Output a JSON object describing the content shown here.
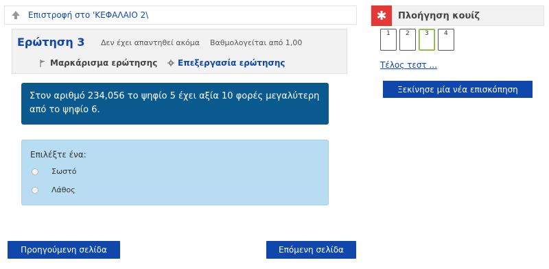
{
  "back": {
    "label": "Επιστροφή στο 'ΚΕΦΑΛΑΙΟ 2\\"
  },
  "question": {
    "number_prefix": "Ερώτηση",
    "number": "3",
    "state": "Δεν έχει απαντηθεί ακόμα",
    "grade": "Βαθμολογείται από 1,00",
    "flag_label": "Μαρκάρισμα ερώτησης",
    "edit_label": "Επεξεργασία ερώτησης",
    "text": "Στον αριθμό 234,056 το ψηφίο 5 έχει αξία 10 φορές μεγαλύτερη από το ψηφίο 6."
  },
  "answer": {
    "prompt": "Επιλέξτε ένα:",
    "options": [
      "Σωστό",
      "Λάθος"
    ]
  },
  "nav": {
    "prev_label": "Προηγούμενη σελίδα",
    "next_label": "Επόμενη σελίδα"
  },
  "quiz_nav": {
    "title": "Πλοήγηση κουίζ",
    "icon": "asterisk-icon",
    "buttons": [
      "1",
      "2",
      "3",
      "4"
    ],
    "current": "3",
    "finish_label": "Τέλος τεστ ...",
    "new_attempt_label": "Ξεκίνησε μία νέα επισκόπηση"
  },
  "colors": {
    "primary": "#0f47ad",
    "question_bg": "#0b5a8f",
    "answer_bg": "#b8dcf2",
    "block_icon": "#e53935"
  }
}
